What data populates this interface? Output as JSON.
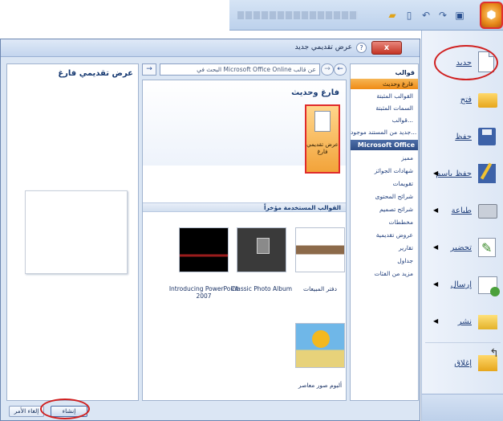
{
  "colors": {
    "highlight_red": "#d02020",
    "selected_orange": "#ef8b16",
    "dialog_bg": "#dbe6f4"
  },
  "quick_access": [
    "folder-open-icon",
    "new-doc-icon",
    "undo-icon",
    "redo-icon",
    "save-icon"
  ],
  "office_menu": {
    "items": [
      {
        "label": "جديد",
        "icon": "new-doc-icon",
        "submenu": false
      },
      {
        "label": "فتح",
        "icon": "folder-open-icon",
        "submenu": false
      },
      {
        "label": "حفظ",
        "icon": "save-icon",
        "submenu": false
      },
      {
        "label": "حفظ باسم",
        "icon": "save-as-icon",
        "submenu": true
      },
      {
        "label": "طباعة",
        "icon": "printer-icon",
        "submenu": true
      },
      {
        "label": "تحضير",
        "icon": "prepare-icon",
        "submenu": true
      },
      {
        "label": "إرسال",
        "icon": "send-icon",
        "submenu": true
      },
      {
        "label": "نشر",
        "icon": "publish-icon",
        "submenu": true
      },
      {
        "label": "إغلاق",
        "icon": "close-doc-icon",
        "submenu": false
      }
    ]
  },
  "dialog": {
    "title": "عرض تقديمي جديد",
    "close_label": "x",
    "help_label": "?",
    "search_placeholder": "البحث في Microsoft Office Online عن قالب",
    "search_btn": "→",
    "back_btn": "←",
    "fwd_btn": "→",
    "categories": {
      "templates_head": "قوالب",
      "items": [
        "فارغ وحديث",
        "القوالب المثبتة",
        "السمات المثبتة",
        "قوالب...",
        "جديد من المستند موجود..."
      ],
      "online_head": "Microsoft Office Online",
      "online_items": [
        "مميز",
        "شهادات الجوائز",
        "تقويمات",
        "شرائح المحتوى",
        "شرائح تصميم",
        "مخططات",
        "عروض تقديمية",
        "تقارير",
        "جداول",
        "مزيد من الفئات"
      ]
    },
    "blank": {
      "heading": "فارغ وحديث",
      "thumb_label": "عرض تقديمي فارغ"
    },
    "recent": {
      "heading": "القوالب المستخدمة مؤخراً",
      "templates": [
        {
          "label": "دفتر المبيعات"
        },
        {
          "label": "Classic Photo Album"
        },
        {
          "label": "Introducing PowerPoint 2007"
        },
        {
          "label": "ألبوم صور معاصر"
        }
      ]
    },
    "preview_title": "عرض تقديمي فارغ",
    "buttons": {
      "create": "إنشاء",
      "cancel": "إلغاء الأمر"
    }
  }
}
